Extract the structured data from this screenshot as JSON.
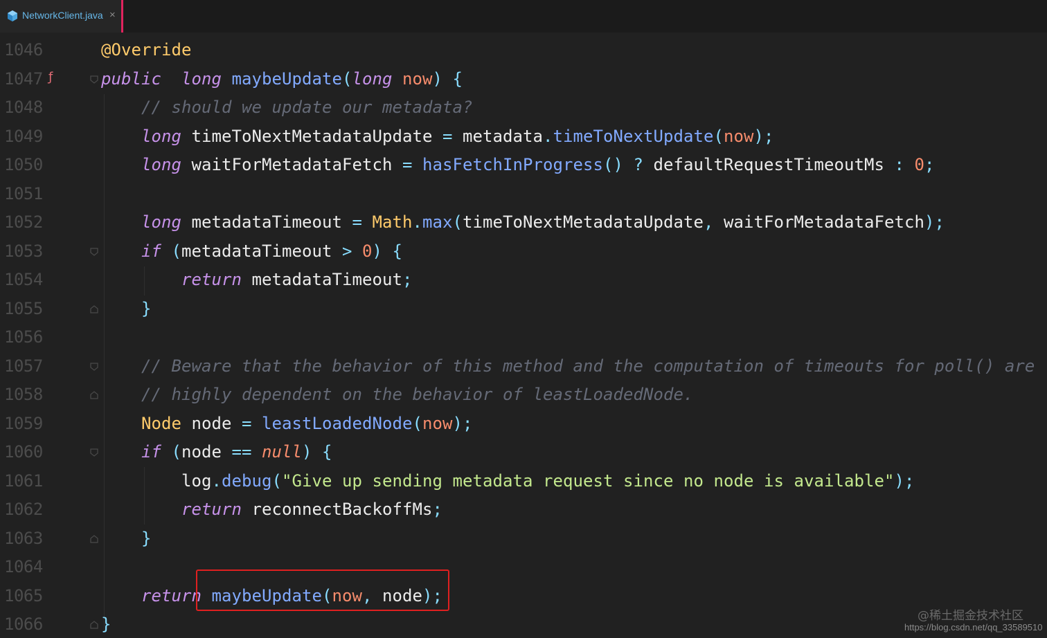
{
  "tab": {
    "label": "NetworkClient.java",
    "close": "×",
    "icon": "java-class-icon"
  },
  "colors": {
    "keyword": "#c792ea",
    "function": "#82aaff",
    "parameter": "#f78c6c",
    "comment": "#656a77",
    "string": "#c3e88d",
    "annotation": "#ffcb6b",
    "highlight": "#e02020"
  },
  "lines": [
    {
      "no": "1046",
      "tokens": [
        [
          "ann",
          "@Override"
        ]
      ]
    },
    {
      "no": "1047",
      "tokens": [
        [
          "kw",
          "public"
        ],
        [
          "",
          "  "
        ],
        [
          "kw",
          "long"
        ],
        [
          "",
          " "
        ],
        [
          "fn",
          "maybeUpdate"
        ],
        [
          "op",
          "("
        ],
        [
          "kw",
          "long"
        ],
        [
          "",
          " "
        ],
        [
          "par",
          "now"
        ],
        [
          "op",
          ")"
        ],
        [
          "",
          " "
        ],
        [
          "op",
          "{"
        ]
      ]
    },
    {
      "no": "1048",
      "tokens": [
        [
          "",
          "    "
        ],
        [
          "cm",
          "// should we update our metadata?"
        ]
      ]
    },
    {
      "no": "1049",
      "tokens": [
        [
          "",
          "    "
        ],
        [
          "kw",
          "long"
        ],
        [
          "",
          " timeToNextMetadataUpdate "
        ],
        [
          "op",
          "="
        ],
        [
          "",
          " metadata"
        ],
        [
          "op",
          "."
        ],
        [
          "fn",
          "timeToNextUpdate"
        ],
        [
          "op",
          "("
        ],
        [
          "par",
          "now"
        ],
        [
          "op",
          ");"
        ]
      ]
    },
    {
      "no": "1050",
      "tokens": [
        [
          "",
          "    "
        ],
        [
          "kw",
          "long"
        ],
        [
          "",
          " waitForMetadataFetch "
        ],
        [
          "op",
          "="
        ],
        [
          "",
          " "
        ],
        [
          "fn",
          "hasFetchInProgress"
        ],
        [
          "op",
          "()"
        ],
        [
          "",
          " "
        ],
        [
          "op",
          "?"
        ],
        [
          "",
          " defaultRequestTimeoutMs "
        ],
        [
          "op",
          ":"
        ],
        [
          "",
          " "
        ],
        [
          "num",
          "0"
        ],
        [
          "op",
          ";"
        ]
      ]
    },
    {
      "no": "1051",
      "tokens": []
    },
    {
      "no": "1052",
      "tokens": [
        [
          "",
          "    "
        ],
        [
          "kw",
          "long"
        ],
        [
          "",
          " metadataTimeout "
        ],
        [
          "op",
          "="
        ],
        [
          "",
          " "
        ],
        [
          "cls",
          "Math"
        ],
        [
          "op",
          "."
        ],
        [
          "fn",
          "max"
        ],
        [
          "op",
          "("
        ],
        [
          "",
          "timeToNextMetadataUpdate"
        ],
        [
          "op",
          ","
        ],
        [
          "",
          " waitForMetadataFetch"
        ],
        [
          "op",
          ");"
        ]
      ]
    },
    {
      "no": "1053",
      "tokens": [
        [
          "",
          "    "
        ],
        [
          "kw",
          "if"
        ],
        [
          "",
          " "
        ],
        [
          "op",
          "("
        ],
        [
          "",
          "metadataTimeout "
        ],
        [
          "op",
          ">"
        ],
        [
          "",
          " "
        ],
        [
          "num",
          "0"
        ],
        [
          "op",
          ")"
        ],
        [
          "",
          " "
        ],
        [
          "op",
          "{"
        ]
      ]
    },
    {
      "no": "1054",
      "tokens": [
        [
          "",
          "        "
        ],
        [
          "kw",
          "return"
        ],
        [
          "",
          " metadataTimeout"
        ],
        [
          "op",
          ";"
        ]
      ]
    },
    {
      "no": "1055",
      "tokens": [
        [
          "",
          "    "
        ],
        [
          "op",
          "}"
        ]
      ]
    },
    {
      "no": "1056",
      "tokens": []
    },
    {
      "no": "1057",
      "tokens": [
        [
          "",
          "    "
        ],
        [
          "cm",
          "// Beware that the behavior of this method and the computation of timeouts for poll() are"
        ]
      ]
    },
    {
      "no": "1058",
      "tokens": [
        [
          "",
          "    "
        ],
        [
          "cm",
          "// highly dependent on the behavior of leastLoadedNode."
        ]
      ]
    },
    {
      "no": "1059",
      "tokens": [
        [
          "",
          "    "
        ],
        [
          "cls",
          "Node"
        ],
        [
          "",
          " node "
        ],
        [
          "op",
          "="
        ],
        [
          "",
          " "
        ],
        [
          "fn",
          "leastLoadedNode"
        ],
        [
          "op",
          "("
        ],
        [
          "par",
          "now"
        ],
        [
          "op",
          ");"
        ]
      ]
    },
    {
      "no": "1060",
      "tokens": [
        [
          "",
          "    "
        ],
        [
          "kw",
          "if"
        ],
        [
          "",
          " "
        ],
        [
          "op",
          "("
        ],
        [
          "",
          "node "
        ],
        [
          "op",
          "=="
        ],
        [
          "",
          " "
        ],
        [
          "nul",
          "null"
        ],
        [
          "op",
          ")"
        ],
        [
          "",
          " "
        ],
        [
          "op",
          "{"
        ]
      ]
    },
    {
      "no": "1061",
      "tokens": [
        [
          "",
          "        log"
        ],
        [
          "op",
          "."
        ],
        [
          "fn",
          "debug"
        ],
        [
          "op",
          "("
        ],
        [
          "str",
          "\"Give up sending metadata request since no node is available\""
        ],
        [
          "op",
          ");"
        ]
      ]
    },
    {
      "no": "1062",
      "tokens": [
        [
          "",
          "        "
        ],
        [
          "kw",
          "return"
        ],
        [
          "",
          " reconnectBackoffMs"
        ],
        [
          "op",
          ";"
        ]
      ]
    },
    {
      "no": "1063",
      "tokens": [
        [
          "",
          "    "
        ],
        [
          "op",
          "}"
        ]
      ]
    },
    {
      "no": "1064",
      "tokens": []
    },
    {
      "no": "1065",
      "tokens": [
        [
          "",
          "    "
        ],
        [
          "kw",
          "return"
        ],
        [
          "",
          " "
        ],
        [
          "fn",
          "maybeUpdate"
        ],
        [
          "op",
          "("
        ],
        [
          "par",
          "now"
        ],
        [
          "op",
          ","
        ],
        [
          "",
          " node"
        ],
        [
          "op",
          ");"
        ]
      ]
    },
    {
      "no": "1066",
      "tokens": [
        [
          "op",
          "}"
        ]
      ]
    }
  ],
  "watermark": {
    "site": "@稀土掘金技术社区",
    "url": "https://blog.csdn.net/qq_33589510"
  }
}
